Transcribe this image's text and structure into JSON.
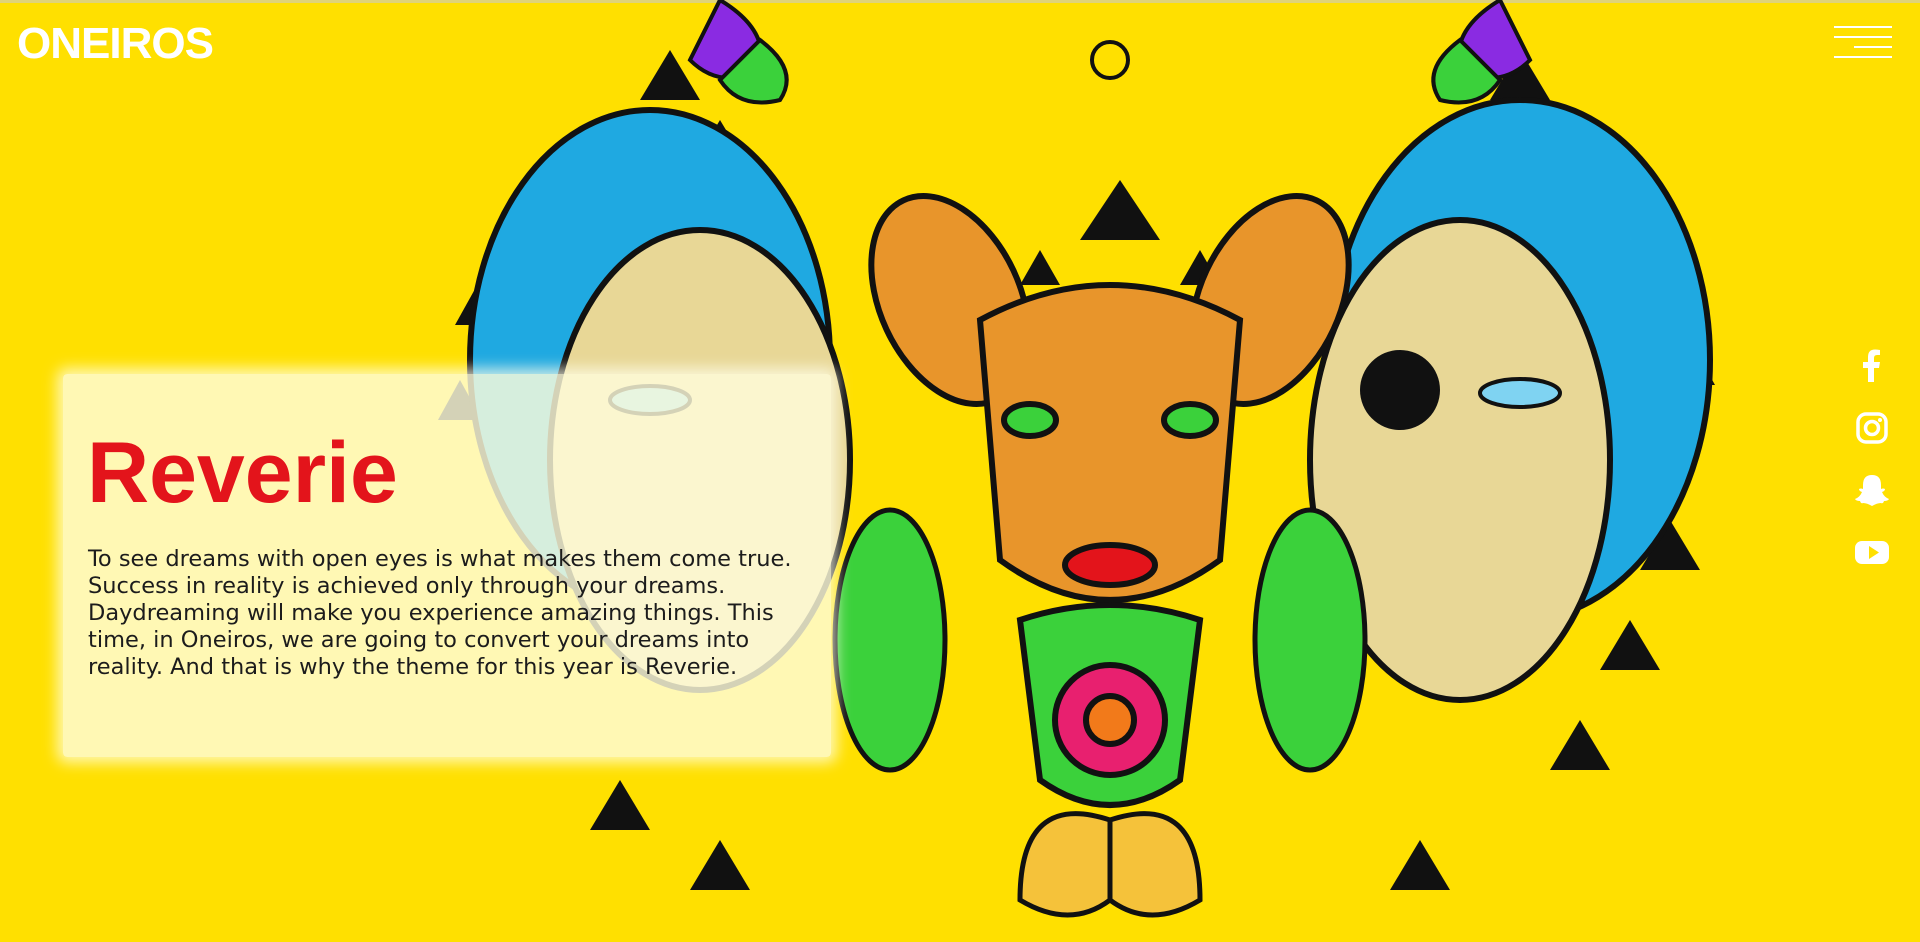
{
  "header": {
    "logo_text": "ONEIROS",
    "menu_icon": "hamburger-menu-icon"
  },
  "hero": {
    "title": "Reverie",
    "description": "To see dreams with open eyes is what makes them come true. Success in reality is achieved only through your dreams. Daydreaming will make you experience amazing things. This time, in Oneiros, we are going to convert your dreams into reality. And that is why the theme for this year is Reverie."
  },
  "social": [
    {
      "name": "facebook",
      "icon": "facebook-icon"
    },
    {
      "name": "instagram",
      "icon": "instagram-icon"
    },
    {
      "name": "snapchat",
      "icon": "snapchat-icon"
    },
    {
      "name": "youtube",
      "icon": "youtube-icon"
    }
  ],
  "colors": {
    "background": "#FFE000",
    "title": "#E3141B",
    "text": "#1c1c1c",
    "logo": "#FFFFFF",
    "art_blue": "#1FA9E1",
    "art_orange": "#E8952B",
    "art_pink": "#E8206F",
    "art_green": "#3BD13B"
  }
}
